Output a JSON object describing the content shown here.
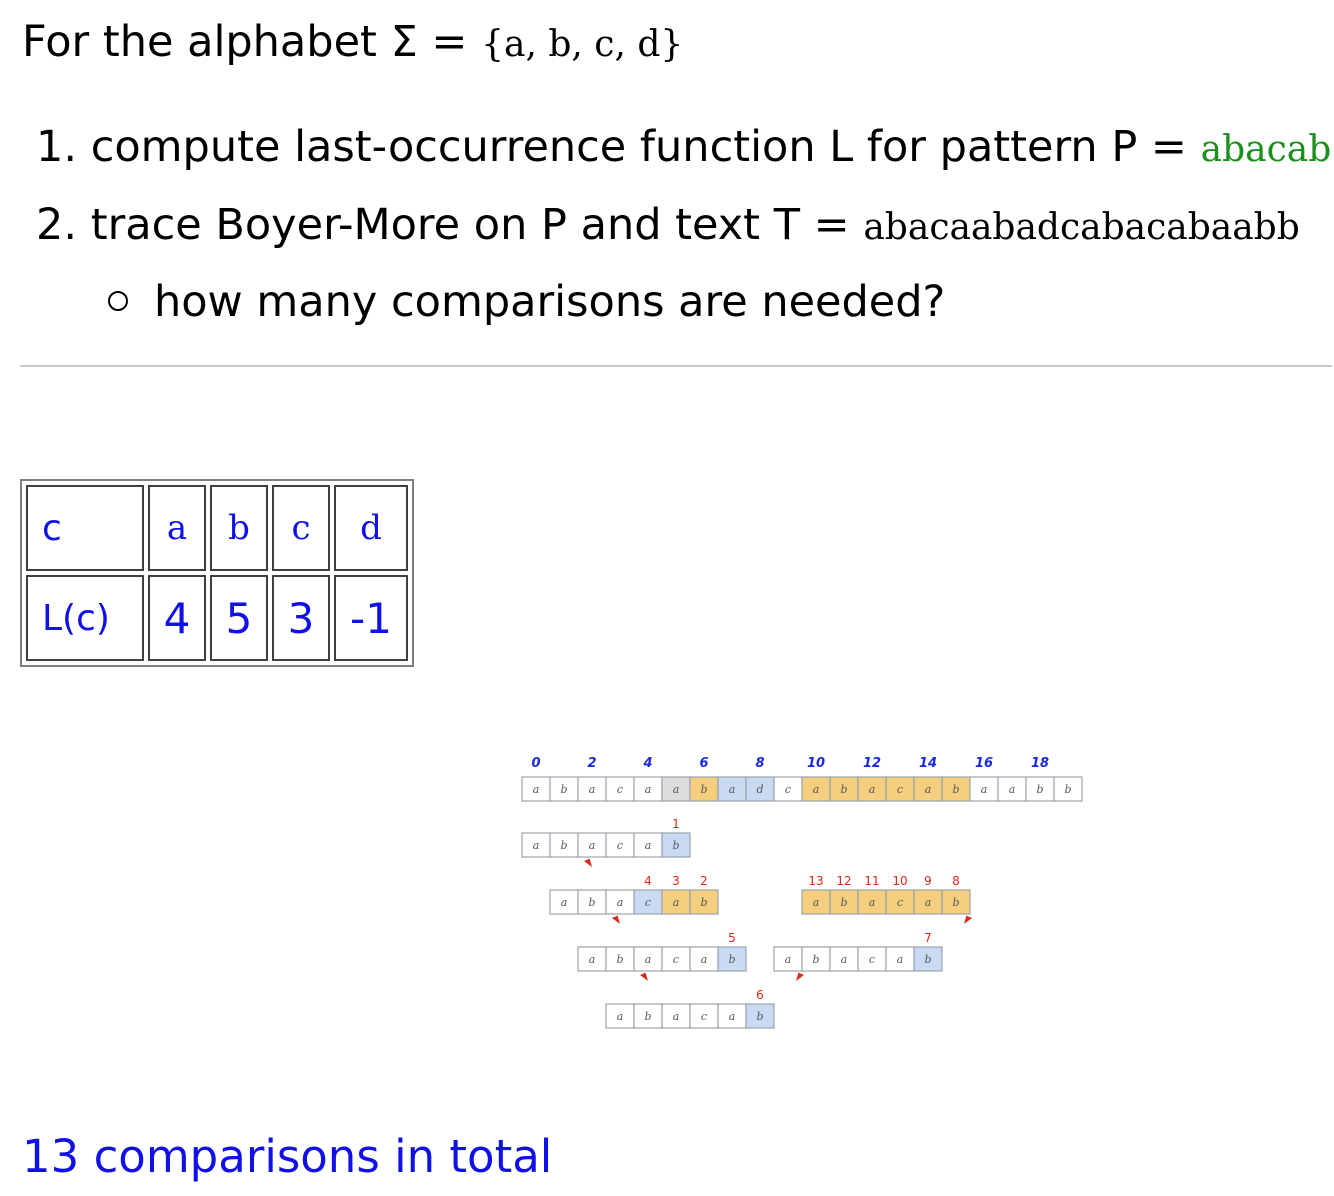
{
  "intro": {
    "prefix": "For the alphabet Σ = ",
    "alphabet": "{a, b, c, d}"
  },
  "tasks": [
    {
      "marker": "1.",
      "text": "compute last-occurrence function L for pattern P = ",
      "value": "abacab",
      "value_color": "#1a8f1a"
    },
    {
      "marker": "2.",
      "text": "trace Boyer-More on P and text T = ",
      "value": "abacaabadcabacabaabb"
    }
  ],
  "subtask": "how many comparisons are needed?",
  "table": {
    "header": [
      "c",
      "a",
      "b",
      "c",
      "d"
    ],
    "values": [
      "L(c)",
      "4",
      "5",
      "3",
      "-1"
    ]
  },
  "trace_figure": {
    "index_labels": [
      "0",
      "2",
      "4",
      "6",
      "8",
      "10",
      "12",
      "14",
      "16",
      "18"
    ],
    "text": [
      "a",
      "b",
      "a",
      "c",
      "a",
      "a",
      "b",
      "a",
      "d",
      "c",
      "a",
      "b",
      "a",
      "c",
      "a",
      "b",
      "a",
      "a",
      "b",
      "b"
    ],
    "text_highlight_colors": {
      "6": "#f5cf7d",
      "15": "#f5cf7d",
      "10": "#f5cf7d",
      "11": "#f5cf7d",
      "12": "#f5cf7d",
      "13": "#f5cf7d",
      "14": "#f5cf7d",
      "5": "#dddddd",
      "7": "#c9daf2",
      "8": "#c9daf2"
    },
    "pattern": [
      "a",
      "b",
      "a",
      "c",
      "a",
      "b"
    ],
    "alignments": [
      {
        "row": 0,
        "shift": 0,
        "compared": [
          5
        ],
        "numbers": [
          "1"
        ]
      },
      {
        "row": 1,
        "shift": 1,
        "compared": [
          3,
          4,
          5
        ],
        "numbers": [
          "4",
          "3",
          "2"
        ]
      },
      {
        "row": 2,
        "shift": 2,
        "compared": [
          5
        ],
        "numbers": [
          "5"
        ]
      },
      {
        "row": 3,
        "shift": 3,
        "compared": [
          5
        ],
        "numbers": [
          "6"
        ]
      },
      {
        "row": 2,
        "shift": 9,
        "compared": [
          5
        ],
        "numbers": [
          "7"
        ]
      },
      {
        "row": 1,
        "shift": 10,
        "compared": [
          0,
          1,
          2,
          3,
          4,
          5
        ],
        "numbers": [
          "13",
          "12",
          "11",
          "10",
          "9",
          "8"
        ]
      }
    ],
    "colors": {
      "match": "#f5cf7d",
      "mismatch": "#c9daf2",
      "arrow": "#d92a1a",
      "index": "#1a2ad9"
    }
  },
  "total": "13 comparisons in total"
}
